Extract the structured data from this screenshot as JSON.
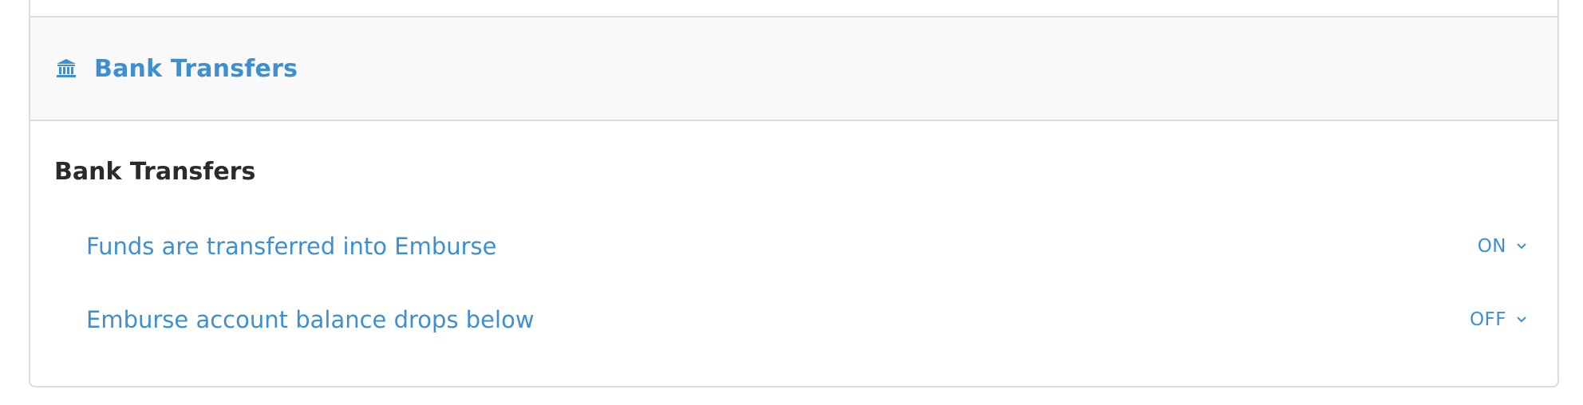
{
  "section": {
    "header_title": "Bank Transfers",
    "header_icon": "bank-icon",
    "group_title": "Bank Transfers",
    "accent_color": "#3d8fd1",
    "rows": [
      {
        "label": "Funds are transferred into Emburse",
        "value": "ON"
      },
      {
        "label": "Emburse account balance drops below",
        "value": "OFF"
      }
    ]
  }
}
